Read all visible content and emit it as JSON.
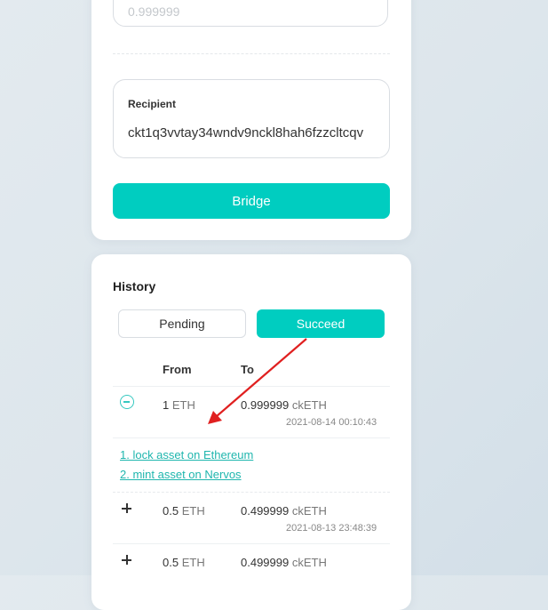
{
  "bridge_form": {
    "amount_value": "0.999999",
    "recipient_label": "Recipient",
    "recipient_value": "ckt1q3vvtay34wndv9nckl8hah6fzzcltcqv",
    "bridge_label": "Bridge"
  },
  "history": {
    "title": "History",
    "tabs": {
      "pending": "Pending",
      "succeed": "Succeed"
    },
    "columns": {
      "from": "From",
      "to": "To"
    },
    "rows": [
      {
        "from_amount": "1",
        "from_unit": "ETH",
        "to_amount": "0.999999",
        "to_unit": "ckETH",
        "time": "2021-08-14 00:10:43",
        "expanded": true
      },
      {
        "from_amount": "0.5",
        "from_unit": "ETH",
        "to_amount": "0.499999",
        "to_unit": "ckETH",
        "time": "2021-08-13 23:48:39",
        "expanded": false
      },
      {
        "from_amount": "0.5",
        "from_unit": "ETH",
        "to_amount": "0.499999",
        "to_unit": "ckETH",
        "time": "",
        "expanded": false
      }
    ],
    "steps": [
      "1. lock asset on Ethereum",
      "2. mint asset on Nervos"
    ]
  },
  "colors": {
    "accent": "#00cdc0",
    "link": "#1fb6ae",
    "annotation_arrow": "#e02020"
  }
}
